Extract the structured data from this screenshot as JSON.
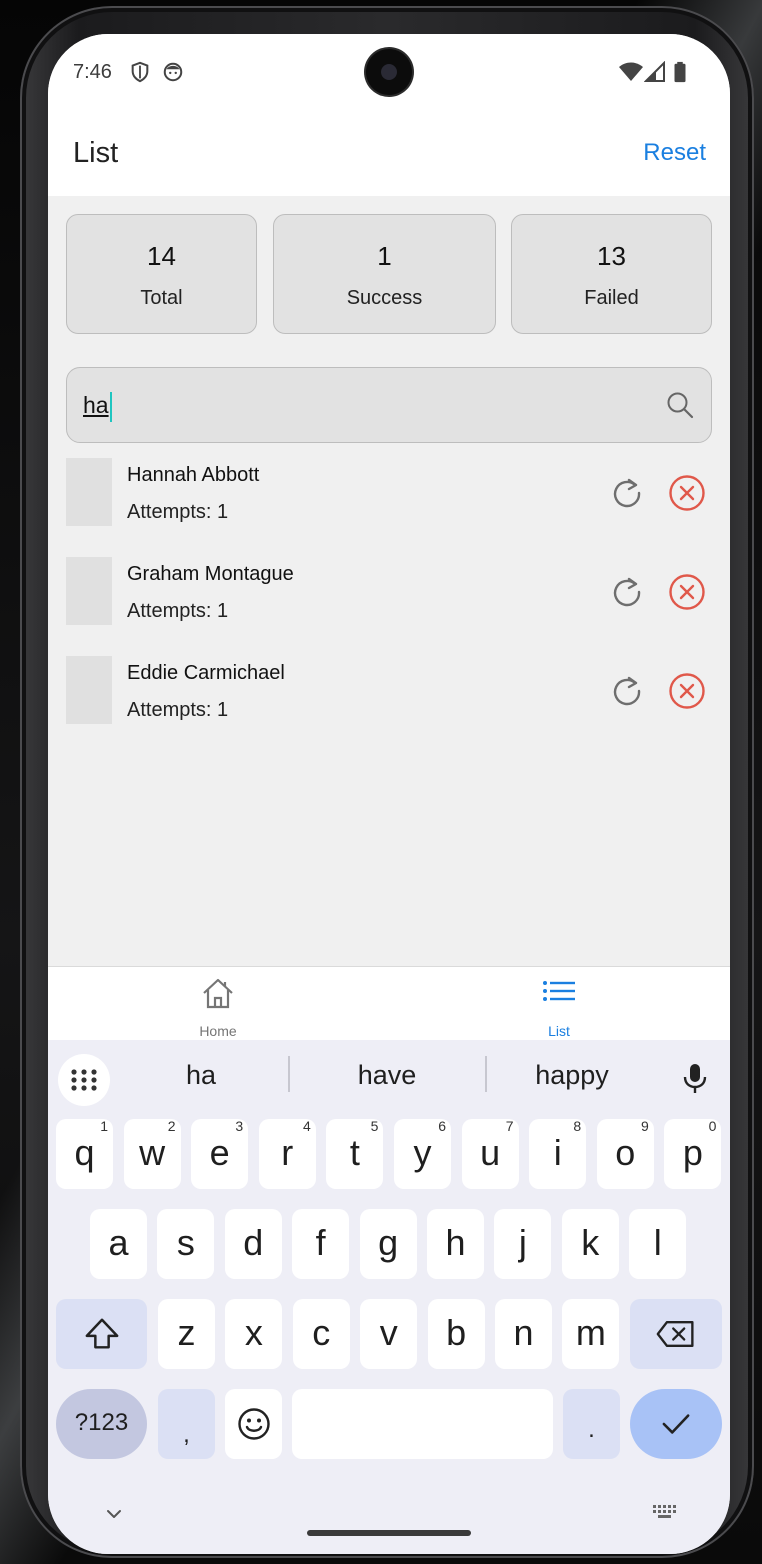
{
  "status_bar": {
    "time": "7:46"
  },
  "app_bar": {
    "title": "List",
    "reset_label": "Reset"
  },
  "stats": [
    {
      "value": "14",
      "label": "Total"
    },
    {
      "value": "1",
      "label": "Success"
    },
    {
      "value": "13",
      "label": "Failed"
    }
  ],
  "search": {
    "value": "ha"
  },
  "items": [
    {
      "name": "Hannah Abbott",
      "attempts": "Attempts: 1"
    },
    {
      "name": "Graham Montague",
      "attempts": "Attempts: 1"
    },
    {
      "name": "Eddie Carmichael",
      "attempts": "Attempts: 1"
    }
  ],
  "bottom_nav": {
    "home_label": "Home",
    "list_label": "List",
    "active": "List",
    "active_color": "#1a7fe0",
    "inactive_color": "#757575"
  },
  "keyboard": {
    "suggestions": [
      "ha",
      "have",
      "happy"
    ],
    "row1": [
      {
        "k": "q",
        "h": "1"
      },
      {
        "k": "w",
        "h": "2"
      },
      {
        "k": "e",
        "h": "3"
      },
      {
        "k": "r",
        "h": "4"
      },
      {
        "k": "t",
        "h": "5"
      },
      {
        "k": "y",
        "h": "6"
      },
      {
        "k": "u",
        "h": "7"
      },
      {
        "k": "i",
        "h": "8"
      },
      {
        "k": "o",
        "h": "9"
      },
      {
        "k": "p",
        "h": "0"
      }
    ],
    "row2": [
      "a",
      "s",
      "d",
      "f",
      "g",
      "h",
      "j",
      "k",
      "l"
    ],
    "row3": [
      "z",
      "x",
      "c",
      "v",
      "b",
      "n",
      "m"
    ],
    "symbols_label": "?123",
    "comma": ",",
    "period": "."
  },
  "colors": {
    "accent": "#1a7fe0",
    "danger": "#e0584a",
    "retry": "#6e6e6e",
    "cursor": "#1fc5c0"
  }
}
